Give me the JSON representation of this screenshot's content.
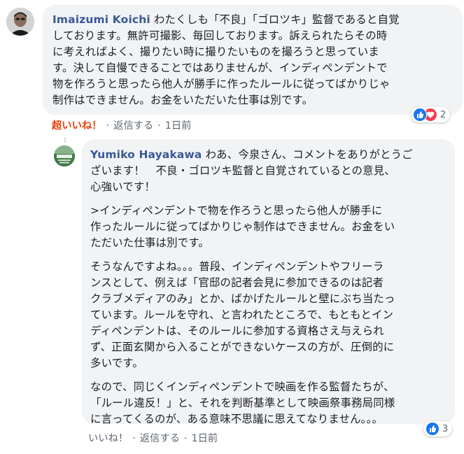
{
  "comments": [
    {
      "author": "Imaizumi Koichi",
      "text": "わたくしも「不良」「ゴロツキ」監督であると自覚\nしております。無許可撮影、毎回しております。訴えられたらその時\nに考えればよく、撮りたい時に撮りたいものを撮ろうと思っていま\nす。決して自慢できることではありませんが、インディペンデントで\n物を作ろうと思ったら他人が勝手に作ったルールに従ってばかりじゃ\n制作はできません。お金をいただいた仕事は別です。",
      "actions": {
        "reaction": "超いいね！",
        "reply": "返信する",
        "time": "1日前"
      },
      "reactions": {
        "icons": [
          "like-icon",
          "love-icon"
        ],
        "count": "2"
      }
    },
    {
      "author": "Yumiko Hayakawa",
      "first_line": "わあ、今泉さん、コメントをありがとうご\nざいます！　不良・ゴロツキ監督と自覚されているとの意見、\n心強いです！",
      "paragraphs": [
        ">インディペンデントで物を作ろうと思ったら他人が勝手に\n作ったルールに従ってばかりじゃ制作はできません。お金をい\nただいた仕事は別です。",
        "そうなんですよね。。。普段、インディペンデントやフリーラ\nンスとして、例えば「官邸の記者会見に参加できるのは記者\nクラブメディアのみ」とか、ばかげたルールと壁にぶち当たっ\nています。ルールを守れ、と言われたところで、もともとイン\nディペンデントは、そのルールに参加する資格さえ与えられ\nず、正面玄関から入ることができないケースの方が、圧倒的に\n多いです。",
        "なので、同じくインディペンデントで映画を作る監督たちが、\n「ルール違反！」と、それを判断基準として映画祭事務局同様\nに言ってくるのが、ある意味不思議に思えてなりません。。。"
      ],
      "actions": {
        "reaction": "いいね！",
        "reply": "返信する",
        "time": "1日前"
      },
      "reactions": {
        "icons": [
          "like-icon"
        ],
        "count": "3"
      }
    }
  ],
  "separator": "·",
  "colors": {
    "bubble": "#f2f3f5",
    "author": "#385898",
    "super_like": "#e9410e",
    "like_blue": "#1877f2",
    "love_red": "#f33e58"
  }
}
